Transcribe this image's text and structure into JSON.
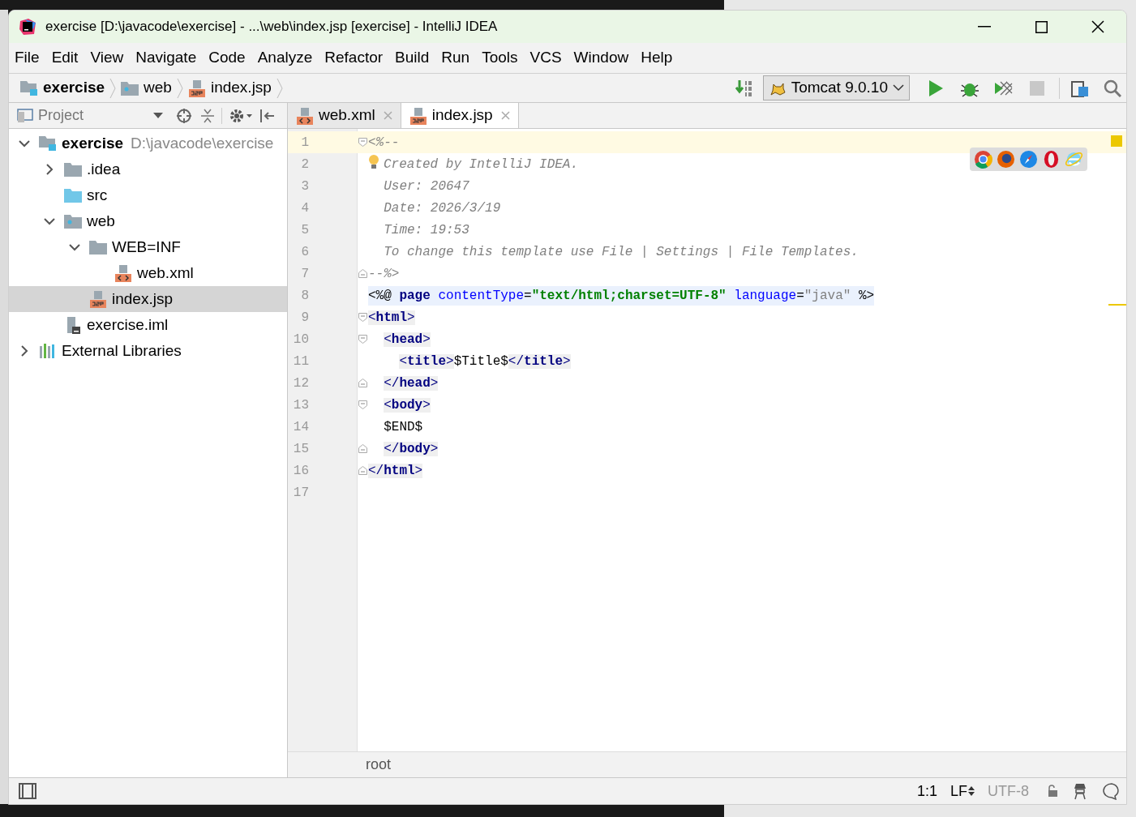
{
  "window": {
    "title": "exercise [D:\\javacode\\exercise] - ...\\web\\index.jsp [exercise] - IntelliJ IDEA"
  },
  "menu": [
    {
      "label": "File"
    },
    {
      "label": "Edit"
    },
    {
      "label": "View"
    },
    {
      "label": "Navigate"
    },
    {
      "label": "Code"
    },
    {
      "label": "Analyze"
    },
    {
      "label": "Refactor"
    },
    {
      "label": "Build"
    },
    {
      "label": "Run"
    },
    {
      "label": "Tools"
    },
    {
      "label": "VCS"
    },
    {
      "label": "Window"
    },
    {
      "label": "Help"
    }
  ],
  "breadcrumbs": [
    {
      "label": "exercise",
      "kind": "project"
    },
    {
      "label": "web",
      "kind": "webfolder"
    },
    {
      "label": "index.jsp",
      "kind": "jsp"
    }
  ],
  "run_config": "Tomcat 9.0.10",
  "project_panel": {
    "title": "Project"
  },
  "tree": [
    {
      "label": "exercise",
      "path": "D:\\javacode\\exercise",
      "kind": "project",
      "expanded": true,
      "selected": false,
      "children": [
        {
          "label": ".idea",
          "kind": "folder",
          "expanded": false,
          "selected": false
        },
        {
          "label": "src",
          "kind": "source",
          "selected": false
        },
        {
          "label": "web",
          "kind": "webfolder",
          "expanded": true,
          "selected": false,
          "children": [
            {
              "label": "WEB=INF",
              "kind": "folder",
              "expanded": true,
              "selected": false,
              "children": [
                {
                  "label": "web.xml",
                  "kind": "xml",
                  "selected": false
                }
              ]
            },
            {
              "label": "index.jsp",
              "kind": "jsp",
              "selected": true
            }
          ]
        },
        {
          "label": "exercise.iml",
          "kind": "iml",
          "selected": false
        }
      ]
    },
    {
      "label": "External Libraries",
      "kind": "library",
      "expanded": false,
      "selected": false
    }
  ],
  "tabs": [
    {
      "label": "web.xml",
      "kind": "xml",
      "selected": false
    },
    {
      "label": "index.jsp",
      "kind": "jsp",
      "selected": true
    }
  ],
  "code": [
    {
      "number": "1",
      "kind": "foldstart",
      "current": true,
      "segments": [
        {
          "kind": "comment",
          "text": "<%--"
        }
      ]
    },
    {
      "number": "2",
      "kind": "plain",
      "current": false,
      "hint": true,
      "segments": [
        {
          "kind": "comment",
          "text": "  Created by IntelliJ IDEA."
        }
      ]
    },
    {
      "number": "3",
      "kind": "plain",
      "current": false,
      "segments": [
        {
          "kind": "comment",
          "text": "  User: 20647"
        }
      ]
    },
    {
      "number": "4",
      "kind": "plain",
      "current": false,
      "segments": [
        {
          "kind": "comment",
          "text": "  Date: 2026/3/19"
        }
      ]
    },
    {
      "number": "5",
      "kind": "plain",
      "current": false,
      "segments": [
        {
          "kind": "comment",
          "text": "  Time: 19:53"
        }
      ]
    },
    {
      "number": "6",
      "kind": "plain",
      "current": false,
      "segments": [
        {
          "kind": "comment",
          "text": "  To change this template use File | Settings | File Templates."
        }
      ]
    },
    {
      "number": "7",
      "kind": "foldend",
      "current": false,
      "segments": [
        {
          "kind": "comment",
          "text": "--%>"
        }
      ]
    },
    {
      "number": "8",
      "kind": "plain",
      "current": false,
      "directive": true,
      "segments": [
        {
          "kind": "text",
          "text": "<%@"
        },
        {
          "kind": "keyword",
          "text": " page"
        },
        {
          "kind": "attr",
          "text": " contentType"
        },
        {
          "kind": "text",
          "text": "="
        },
        {
          "kind": "string",
          "text": "\"text/html;charset=UTF-8\""
        },
        {
          "kind": "attr",
          "text": " language"
        },
        {
          "kind": "text",
          "text": "="
        },
        {
          "kind": "value",
          "text": "\"java\""
        },
        {
          "kind": "text",
          "text": " %>"
        }
      ]
    },
    {
      "number": "9",
      "kind": "foldstart",
      "current": false,
      "segments": [
        {
          "kind": "tag",
          "text": "<**html**>"
        }
      ]
    },
    {
      "number": "10",
      "kind": "foldstart",
      "current": false,
      "segments": [
        {
          "kind": "tag",
          "text": "  <**head**>"
        }
      ]
    },
    {
      "number": "11",
      "kind": "plain",
      "current": false,
      "segments": [
        {
          "kind": "tag",
          "text": "    <**title**>"
        },
        {
          "kind": "text",
          "text": "$Title$"
        },
        {
          "kind": "tag",
          "text": "</**title**>"
        }
      ]
    },
    {
      "number": "12",
      "kind": "foldend",
      "current": false,
      "segments": [
        {
          "kind": "tag",
          "text": "  </**head**>"
        }
      ]
    },
    {
      "number": "13",
      "kind": "foldstart",
      "current": false,
      "segments": [
        {
          "kind": "tag",
          "text": "  <**body**>"
        }
      ]
    },
    {
      "number": "14",
      "kind": "plain",
      "current": false,
      "segments": [
        {
          "kind": "text",
          "text": "  $END$"
        }
      ]
    },
    {
      "number": "15",
      "kind": "foldend",
      "current": false,
      "segments": [
        {
          "kind": "tag",
          "text": "  </**body**>"
        }
      ]
    },
    {
      "number": "16",
      "kind": "foldend",
      "current": false,
      "segments": [
        {
          "kind": "tag",
          "text": "</**html**>"
        }
      ]
    },
    {
      "number": "17",
      "kind": "plain",
      "current": false
    }
  ],
  "editor_breadcrumb": "root",
  "status_bar": {
    "position": "1:1",
    "line_separator": "LF",
    "encoding": "UTF-8"
  }
}
